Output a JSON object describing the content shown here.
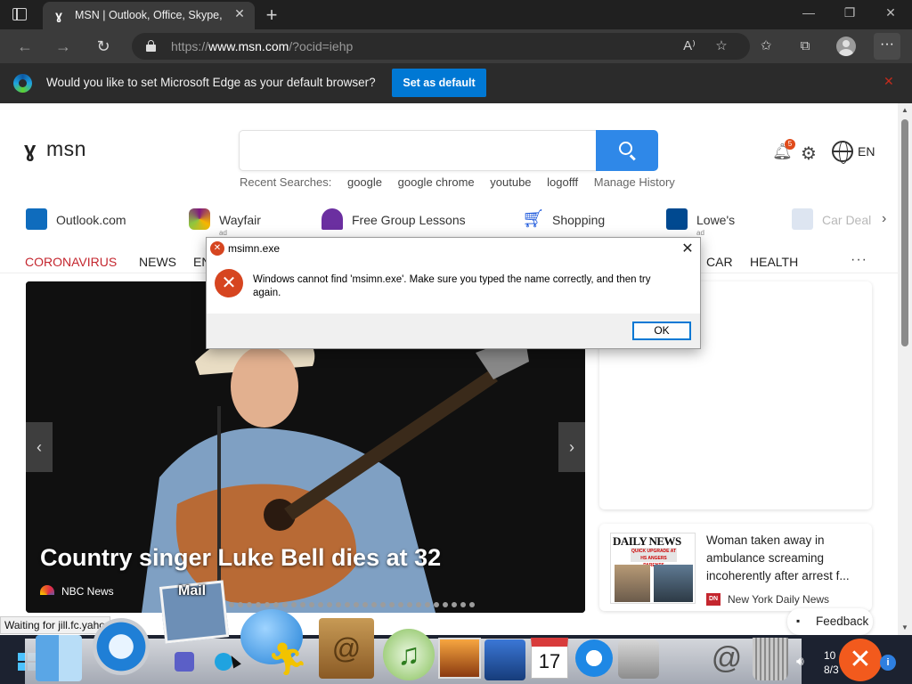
{
  "browser": {
    "tab_title": "MSN | Outlook, Office, Skype, Bi",
    "url_prefix": "https://",
    "url_domain": "www.msn.com",
    "url_path": "/?ocid=iehp"
  },
  "infobar": {
    "message": "Would you like to set Microsoft Edge as your default browser?",
    "button": "Set as default"
  },
  "msn": {
    "logo_text": "msn",
    "recent_label": "Recent Searches:",
    "recent_terms": [
      "google",
      "google chrome",
      "youtube",
      "logofff"
    ],
    "manage_history": "Manage History",
    "notification_count": "5",
    "language": "EN"
  },
  "quicklinks": [
    {
      "label": "Outlook.com",
      "ad": "",
      "color": "#0f6cbd"
    },
    {
      "label": "Wayfair",
      "ad": "ad",
      "color": "#7f187f"
    },
    {
      "label": "Free Group Lessons",
      "ad": "",
      "color": "#6b2fa0"
    },
    {
      "label": "Shopping",
      "ad": "",
      "color": "#1a56db"
    },
    {
      "label": "Lowe's",
      "ad": "ad",
      "color": "#004990"
    },
    {
      "label": "Car Deal",
      "ad": "",
      "color": "#9fb6d8"
    }
  ],
  "categories": {
    "left": [
      "CORONAVIRUS",
      "NEWS",
      "EN"
    ],
    "right": [
      "CAR",
      "HEALTH"
    ]
  },
  "hero": {
    "title": "Country singer Luke Bell dies at 32",
    "source": "NBC News"
  },
  "news_card": {
    "masthead": "DAILY NEWS",
    "thumb_headline": "QUICK UPGRADE AT HS ANGERS PARENTS",
    "title": "Woman taken away in ambulance screaming incoherently after arrest f...",
    "source_logo": "DN",
    "source": "New York Daily News"
  },
  "feedback": "Feedback",
  "dialog": {
    "title": "msimn.exe",
    "message": "Windows cannot find 'msimn.exe'. Make sure you typed the name correctly, and then try again.",
    "ok": "OK"
  },
  "status": "Waiting for jill.fc.yahoo",
  "dock": {
    "mail_label": "Mail"
  },
  "tray": {
    "time": "10",
    "date": "8/3"
  }
}
